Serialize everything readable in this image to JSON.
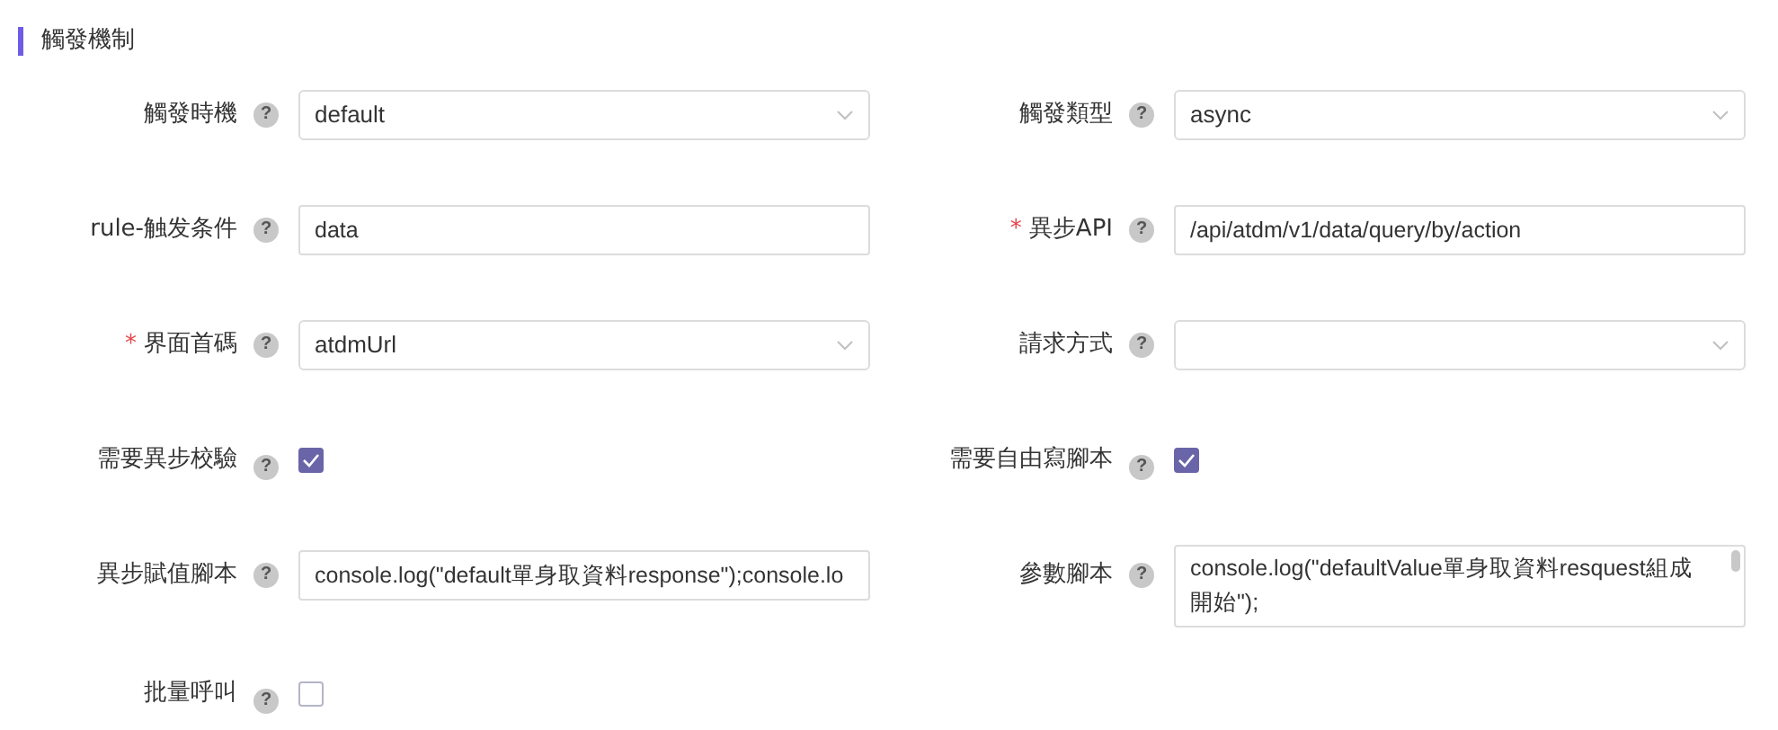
{
  "section": {
    "title": "觸發機制"
  },
  "rows": [
    [
      {
        "label": "觸發時機",
        "help": "?",
        "kind": "select",
        "value": "default"
      },
      {
        "label": "觸發類型",
        "help": "?",
        "kind": "select",
        "value": "async"
      }
    ],
    [
      {
        "label": "rule-触发条件",
        "help": "?",
        "kind": "input",
        "value": "data"
      },
      {
        "required_mark": "*",
        "label": "異步API",
        "help": "?",
        "kind": "input",
        "value": "/api/atdm/v1/data/query/by/action"
      }
    ],
    [
      {
        "required_mark": "*",
        "label": "界面首碼",
        "help": "?",
        "kind": "select",
        "value": "atdmUrl"
      },
      {
        "label": "請求方式",
        "help": "?",
        "kind": "select"
      }
    ],
    [
      {
        "label": "需要異步校驗",
        "help": "?",
        "kind": "checkbox",
        "checked": true
      },
      {
        "label": "需要自由寫腳本",
        "help": "?",
        "kind": "checkbox",
        "checked": true
      }
    ],
    [
      {
        "label": "異步賦值腳本",
        "help": "?",
        "kind": "input",
        "value": "console.log(\"default單身取資料response\");console.lo"
      },
      {
        "label": "參數腳本",
        "help": "?",
        "kind": "textarea",
        "value": "console.log(\"defaultValue單身取資料resquest組成開始\");"
      }
    ],
    [
      {
        "label": "批量呼叫",
        "help": "?",
        "kind": "checkbox",
        "checked": false
      }
    ]
  ]
}
